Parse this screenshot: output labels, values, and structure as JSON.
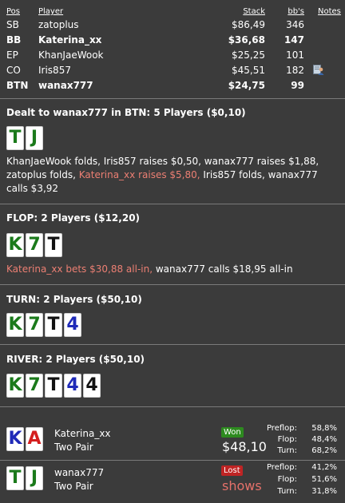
{
  "table_header": {
    "pos": "Pos",
    "player": "Player",
    "stack": "Stack",
    "bbs": "bb's",
    "notes": "Notes"
  },
  "players": [
    {
      "pos": "SB",
      "name": "zatoplus",
      "stack": "$86,49",
      "bbs": "346",
      "bold": false,
      "note": false
    },
    {
      "pos": "BB",
      "name": "Katerina_xx",
      "stack": "$36,68",
      "bbs": "147",
      "bold": true,
      "note": false
    },
    {
      "pos": "EP",
      "name": "KhanJaeWook",
      "stack": "$25,25",
      "bbs": "101",
      "bold": false,
      "note": false
    },
    {
      "pos": "CO",
      "name": "Iris857",
      "stack": "$45,51",
      "bbs": "182",
      "bold": false,
      "note": true
    },
    {
      "pos": "BTN",
      "name": "wanax777",
      "stack": "$24,75",
      "bbs": "99",
      "bold": true,
      "note": false
    }
  ],
  "preflop": {
    "title": "Dealt to wanax777 in BTN: 5 Players ($0,10)",
    "cards": [
      {
        "rank": "T",
        "suit": "green"
      },
      {
        "rank": "J",
        "suit": "green"
      }
    ],
    "actions_a": "KhanJaeWook folds, Iris857 raises $0,50, wanax777 raises $1,88, zatoplus folds, ",
    "actions_hl": "Katerina_xx raises $5,80,",
    "actions_b": " Iris857 folds, wanax777 calls $3,92"
  },
  "flop": {
    "title": "FLOP: 2 Players ($12,20)",
    "cards": [
      {
        "rank": "K",
        "suit": "green"
      },
      {
        "rank": "7",
        "suit": "green"
      },
      {
        "rank": "T",
        "suit": "black"
      }
    ],
    "actions_hl": "Katerina_xx bets $30,88 all-in,",
    "actions_b": " wanax777 calls $18,95 all-in"
  },
  "turn": {
    "title": "TURN: 2 Players ($50,10)",
    "cards": [
      {
        "rank": "K",
        "suit": "green"
      },
      {
        "rank": "7",
        "suit": "green"
      },
      {
        "rank": "T",
        "suit": "black"
      },
      {
        "rank": "4",
        "suit": "blue"
      }
    ]
  },
  "river": {
    "title": "RIVER: 2 Players ($50,10)",
    "cards": [
      {
        "rank": "K",
        "suit": "green"
      },
      {
        "rank": "7",
        "suit": "green"
      },
      {
        "rank": "T",
        "suit": "black"
      },
      {
        "rank": "4",
        "suit": "blue"
      },
      {
        "rank": "4",
        "suit": "black"
      }
    ]
  },
  "results": [
    {
      "name": "Katerina_xx",
      "hand": "Two Pair",
      "cards": [
        {
          "rank": "K",
          "suit": "blue"
        },
        {
          "rank": "A",
          "suit": "red"
        }
      ],
      "badge": "Won",
      "amount": "$48,10",
      "equity": [
        {
          "label": "Preflop:",
          "value": "58,8%"
        },
        {
          "label": "Flop:",
          "value": "48,4%"
        },
        {
          "label": "Turn:",
          "value": "68,2%"
        }
      ]
    },
    {
      "name": "wanax777",
      "hand": "Two Pair",
      "cards": [
        {
          "rank": "T",
          "suit": "green"
        },
        {
          "rank": "J",
          "suit": "green"
        }
      ],
      "badge": "Lost",
      "amount": "shows",
      "equity": [
        {
          "label": "Preflop:",
          "value": "41,2%"
        },
        {
          "label": "Flop:",
          "value": "51,6%"
        },
        {
          "label": "Turn:",
          "value": "31,8%"
        }
      ]
    }
  ],
  "colors": {
    "background": "#3b3b3b",
    "highlight_text": "#ec7f73",
    "won_badge": "#2d8a1f",
    "lost_badge": "#bf2424"
  },
  "icons": {
    "note": "note-user-icon"
  }
}
